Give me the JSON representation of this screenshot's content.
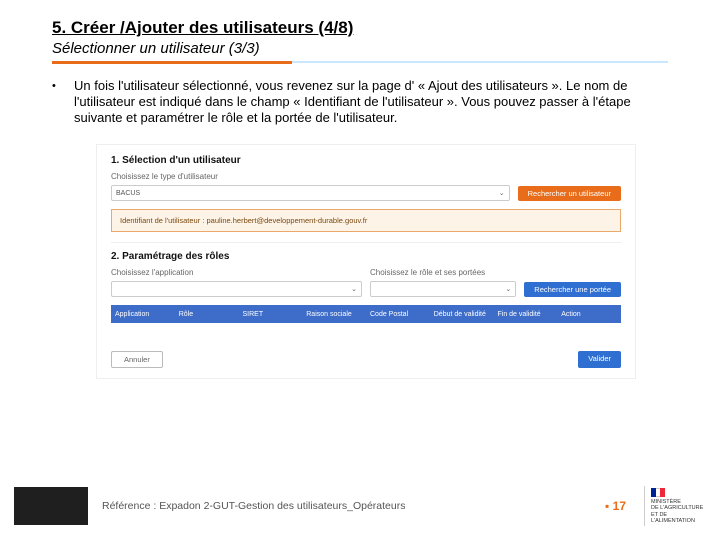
{
  "header": {
    "title": "5. Créer /Ajouter des utilisateurs (4/8)",
    "subtitle": "Sélectionner un utilisateur (3/3)"
  },
  "body": {
    "paragraph": "Un fois l'utilisateur sélectionné, vous revenez sur la page d' « Ajout des utilisateurs ». Le nom de l'utilisateur est indiqué dans le champ « Identifiant de l'utilisateur ». Vous pouvez passer à l'étape suivante et paramétrer le rôle et la portée de l'utilisateur."
  },
  "screenshot": {
    "section1": {
      "title": "1. Sélection d'un utilisateur",
      "subtitle": "Choisissez le type d'utilisateur",
      "select_value": "BACUS",
      "search_btn": "Rechercher un utilisateur",
      "identifier_line": "Identifiant de l'utilisateur : pauline.herbert@developpement-durable.gouv.fr"
    },
    "section2": {
      "title": "2. Paramétrage des rôles",
      "sub_left": "Choisissez l'application",
      "sub_right": "Choisissez le rôle et ses portées",
      "search_btn": "Rechercher une portée"
    },
    "table": {
      "headers": [
        "Application",
        "Rôle",
        "SIRET",
        "Raison sociale",
        "Code Postal",
        "Début de validité",
        "Fin de validité",
        "Action"
      ]
    },
    "buttons": {
      "cancel": "Annuler",
      "validate": "Valider"
    }
  },
  "footer": {
    "reference": "Référence : Expadon 2-GUT-Gestion des utilisateurs_Opérateurs",
    "page": "17",
    "ministry_l1": "MINISTÈRE",
    "ministry_l2": "DE L'AGRICULTURE",
    "ministry_l3": "ET DE L'ALIMENTATION"
  }
}
